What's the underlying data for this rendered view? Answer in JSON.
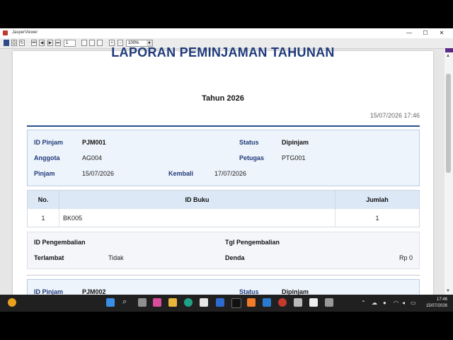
{
  "window": {
    "title": "JasperViewer",
    "minimize": "—",
    "maximize": "☐",
    "close": "✕"
  },
  "toolbar": {
    "page": "1",
    "zoom": "100%",
    "zoom_dd": "▼"
  },
  "report": {
    "title": "LAPORAN PEMINJAMAN TAHUNAN",
    "subtitle": "Tahun 2026",
    "printed": "15/07/2026 17:46",
    "labels": {
      "id_pinjam": "ID Pinjam",
      "status": "Status",
      "anggota": "Anggota",
      "petugas": "Petugas",
      "pinjam": "Pinjam",
      "kembali": "Kembali",
      "id_pengembalian": "ID Pengembalian",
      "tgl_pengembalian": "Tgl Pengembalian",
      "terlambat": "Terlambat",
      "denda": "Denda"
    },
    "table_headers": [
      "No.",
      "ID Buku",
      "Jumlah"
    ],
    "loans": [
      {
        "id_pinjam": "PJM001",
        "status": "Dipinjam",
        "anggota": "AG004",
        "petugas": "PTG001",
        "pinjam": "15/07/2026",
        "kembali": "17/07/2026",
        "items": [
          {
            "no": "1",
            "id_buku": "BK005",
            "jumlah": "1"
          }
        ],
        "id_pengembalian": "",
        "tgl_pengembalian": "",
        "terlambat": "Tidak",
        "denda": "Rp 0"
      },
      {
        "id_pinjam": "PJM002",
        "status": "Dipinjam"
      }
    ]
  },
  "taskbar": {
    "time": "17:46",
    "date": "15/07/2026"
  }
}
